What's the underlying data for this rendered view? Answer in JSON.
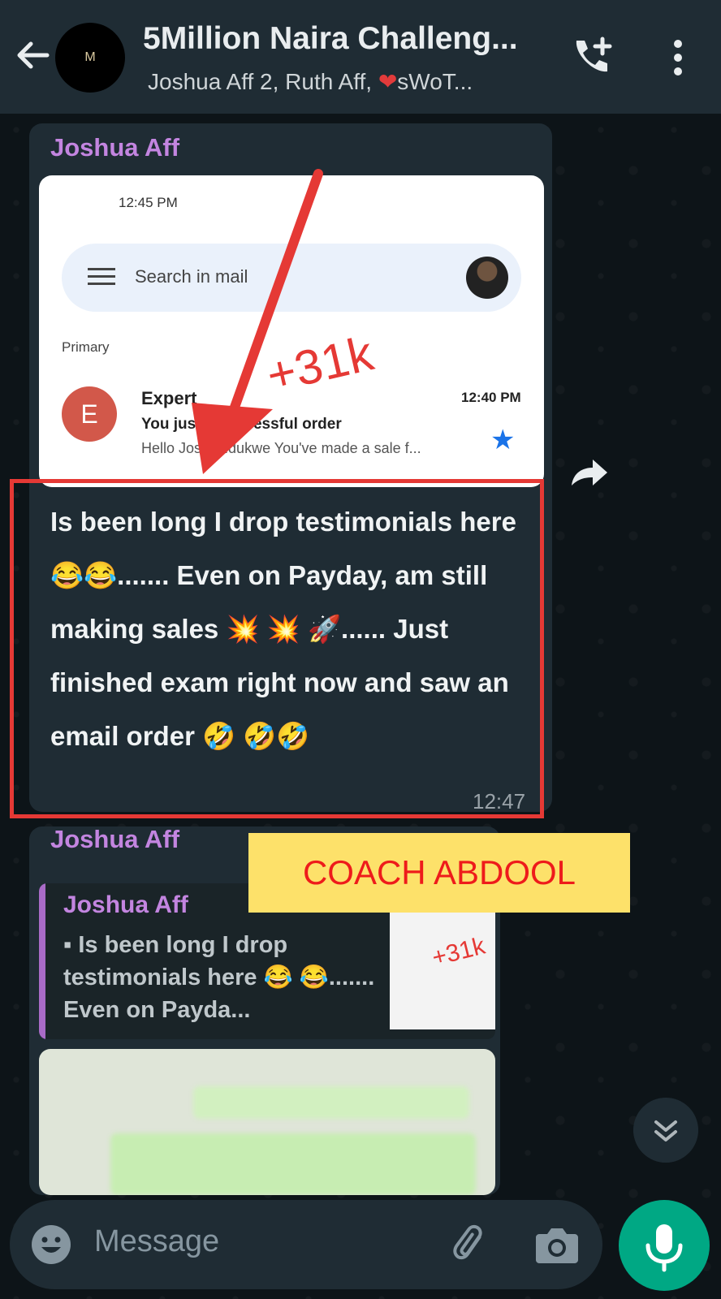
{
  "header": {
    "title": "5Million Naira Challeng...",
    "avatar_initial": "M",
    "subtitle_part1": "Joshua Aff 2,  Ruth Aff, ",
    "subtitle_heart": "❤",
    "subtitle_part2": "sWoT..."
  },
  "message1": {
    "sender": "Joshua Aff",
    "screenshot": {
      "status_time": "12:45 PM",
      "search_placeholder": "Search in mail",
      "section_label": "Primary",
      "email_avatar": "E",
      "email_from": "Expert",
      "email_time": "12:40 PM",
      "email_subject": "You just       a successful order",
      "email_preview": "Hello Jos     a Ndukwe You've made a sale f..."
    },
    "annotation": "+31k",
    "text": "Is been long I drop testimonials here 😂😂....... Even on Payday, am still making sales 💥 💥 🚀...... Just finished exam right now and saw an email order 🤣 🤣🤣",
    "time": "12:47"
  },
  "message2": {
    "sender": "Joshua Aff",
    "quote_sender": "Joshua Aff",
    "quote_text": "▪ Is been long I drop testimonials here 😂 😂....... Even on Payda...",
    "quote_thumb_label": "+31k"
  },
  "watermark": "COACH ABDOOL",
  "input": {
    "placeholder": "Message"
  },
  "colors": {
    "header_bg": "#1f2c34",
    "bubble_bg": "#1f2c34",
    "sender_color": "#c385e0",
    "accent_green": "#00a884",
    "annotation_red": "#e53935",
    "watermark_bg": "#fde16a"
  },
  "icons": [
    "back-arrow-icon",
    "add-call-icon",
    "menu-dots-icon",
    "forward-icon",
    "scroll-down-icon",
    "emoji-icon",
    "attach-icon",
    "camera-icon",
    "mic-icon",
    "star-icon",
    "hamburger-icon"
  ]
}
